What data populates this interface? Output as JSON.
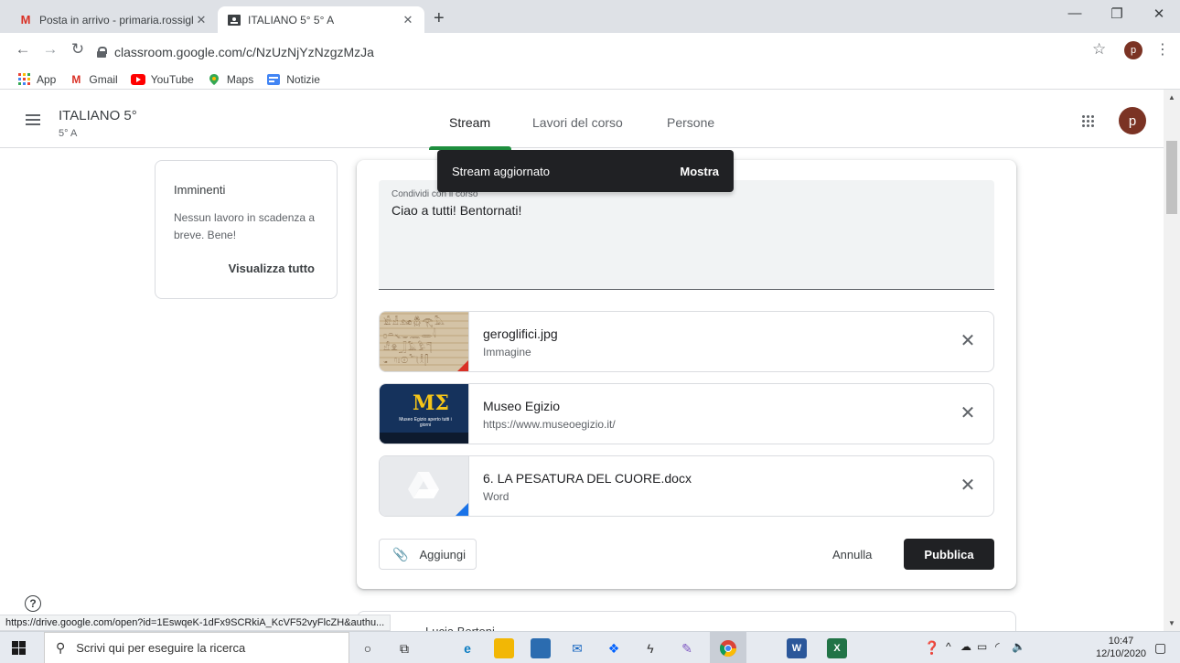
{
  "browser": {
    "tabs": [
      {
        "title": "Posta in arrivo - primaria.rossiglic",
        "favicon": "gmail-icon"
      },
      {
        "title": "ITALIANO 5° 5° A",
        "favicon": "classroom-icon"
      }
    ],
    "url": "classroom.google.com/c/NzUzNjYzNzgzMzJa",
    "profile_letter": "p",
    "bookmarks": [
      {
        "label": "App",
        "icon": "apps-grid-icon"
      },
      {
        "label": "Gmail",
        "icon": "gmail-icon"
      },
      {
        "label": "YouTube",
        "icon": "youtube-icon"
      },
      {
        "label": "Maps",
        "icon": "maps-icon"
      },
      {
        "label": "Notizie",
        "icon": "news-icon"
      }
    ],
    "status_url": "https://drive.google.com/open?id=1EswqeK-1dFx9SCRkiA_KcVF52vyFlcZH&authu..."
  },
  "classroom": {
    "class_title": "ITALIANO 5°",
    "class_section": "5° A",
    "nav": [
      "Stream",
      "Lavori del corso",
      "Persone"
    ],
    "active_nav": "Stream",
    "profile_letter": "p",
    "upcoming": {
      "title": "Imminenti",
      "message": "Nessun lavoro in scadenza a breve. Bene!",
      "view_all": "Visualizza tutto"
    },
    "composer": {
      "label": "Condividi con il corso",
      "text": "Ciao a tutti! Bentornati!",
      "attachments": [
        {
          "name": "geroglifici.jpg",
          "type": "Immagine",
          "thumb": "hieroglyphs-image"
        },
        {
          "name": "Museo Egizio",
          "type": "https://www.museoegizio.it/",
          "thumb": "museo-egizio-site"
        },
        {
          "name": "6. LA PESATURA DEL CUORE.docx",
          "type": "Word",
          "thumb": "drive-doc"
        }
      ],
      "add_label": "Aggiungi",
      "cancel_label": "Annulla",
      "publish_label": "Pubblica",
      "museo_logo_text": "MΣ",
      "museo_tagline": "Museo Egizio aperto tutti i giorni"
    },
    "snackbar": {
      "message": "Stream aggiornato",
      "action": "Mostra"
    },
    "next_post_author": "Lucia Bertoni"
  },
  "taskbar": {
    "search_placeholder": "Scrivi qui per eseguire la ricerca",
    "time": "10:47",
    "date": "12/10/2020"
  },
  "colors": {
    "accent_green": "#1e8e3e",
    "avatar": "#7b3324",
    "publish_button": "#202124",
    "snackbar": "#202124"
  }
}
